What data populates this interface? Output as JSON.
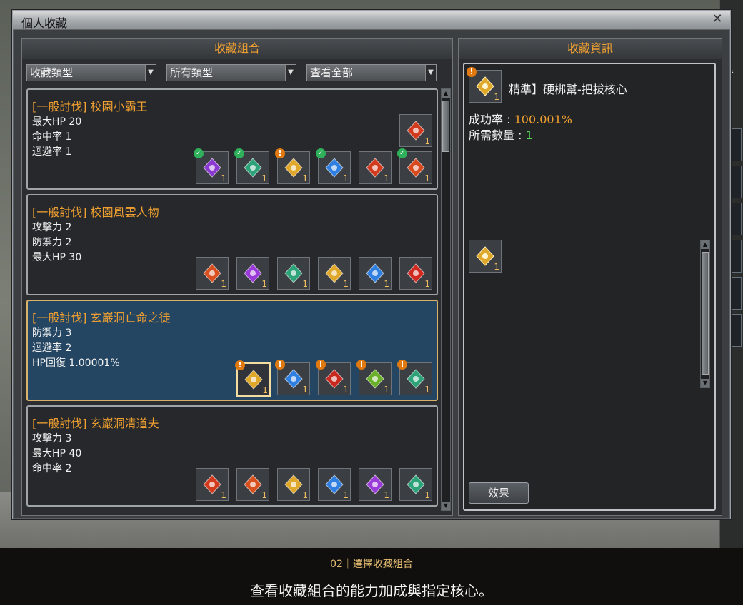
{
  "window": {
    "title": "個人收藏",
    "close_glyph": "✕"
  },
  "left_panel": {
    "title": "收藏組合",
    "filters": [
      {
        "label": "收藏類型"
      },
      {
        "label": "所有類型"
      },
      {
        "label": "查看全部"
      }
    ],
    "cards": [
      {
        "name": "[一般討伐] 校園小霸王",
        "stats": [
          "最大HP 20",
          "命中率 1",
          "迴避率 1"
        ],
        "reward": {
          "count": "1",
          "color": "#d23a1e"
        },
        "items": [
          {
            "count": "1",
            "color": "#8a3ad0",
            "status": "check"
          },
          {
            "count": "1",
            "color": "#2ea37a",
            "status": "check"
          },
          {
            "count": "1",
            "color": "#e0a82a",
            "status": "warn"
          },
          {
            "count": "1",
            "color": "#2f7fe0",
            "status": "check"
          },
          {
            "count": "1",
            "color": "#d23a1e",
            "status": "none"
          },
          {
            "count": "1",
            "color": "#d84a1e",
            "status": "check"
          }
        ]
      },
      {
        "name": "[一般討伐] 校園風雲人物",
        "stats": [
          "攻擊力 2",
          "防禦力 2",
          "最大HP 30"
        ],
        "items": [
          {
            "count": "1",
            "color": "#d85020",
            "status": "none"
          },
          {
            "count": "1",
            "color": "#9a3ad8",
            "status": "none"
          },
          {
            "count": "1",
            "color": "#2ea37a",
            "status": "none"
          },
          {
            "count": "1",
            "color": "#e0a82a",
            "status": "none"
          },
          {
            "count": "1",
            "color": "#2f7fe0",
            "status": "none"
          },
          {
            "count": "1",
            "color": "#d02a20",
            "status": "none"
          }
        ]
      },
      {
        "name": "[一般討伐] 玄巖洞亡命之徒",
        "stats": [
          "防禦力 3",
          "迴避率 2",
          "HP回復 1.00001%"
        ],
        "items": [
          {
            "count": "1",
            "color": "#e0a82a",
            "status": "warn",
            "active": true
          },
          {
            "count": "1",
            "color": "#2f7fe0",
            "status": "warn"
          },
          {
            "count": "1",
            "color": "#c8281e",
            "status": "warn"
          },
          {
            "count": "1",
            "color": "#6ab02a",
            "status": "warn"
          },
          {
            "count": "1",
            "color": "#2ea37a",
            "status": "warn"
          }
        ]
      },
      {
        "name": "[一般討伐] 玄巖洞清道夫",
        "stats": [
          "攻擊力 3",
          "最大HP 40",
          "命中率 2"
        ],
        "items": [
          {
            "count": "1",
            "color": "#d23a1e",
            "status": "none"
          },
          {
            "count": "1",
            "color": "#d8501e",
            "status": "none"
          },
          {
            "count": "1",
            "color": "#e0a82a",
            "status": "none"
          },
          {
            "count": "1",
            "color": "#2f7fe0",
            "status": "none"
          },
          {
            "count": "1",
            "color": "#9a3ad8",
            "status": "none"
          },
          {
            "count": "1",
            "color": "#2ea37a",
            "status": "none"
          }
        ]
      }
    ]
  },
  "right_panel": {
    "title": "收藏資訊",
    "item_name": "精準】硬梆幫-把拔核心",
    "item_count": "1",
    "item_color": "#e0a82a",
    "success_label": "成功率 : ",
    "success_value": "100.001%",
    "qty_label": "所需數量 : ",
    "qty_value": "1",
    "target_count": "1",
    "effect_button": "效果"
  },
  "caption": {
    "step": "02｜選擇收藏組合",
    "text": "查看收藏組合的能力加成與指定核心。"
  },
  "side_window": {
    "title_char": "背"
  }
}
